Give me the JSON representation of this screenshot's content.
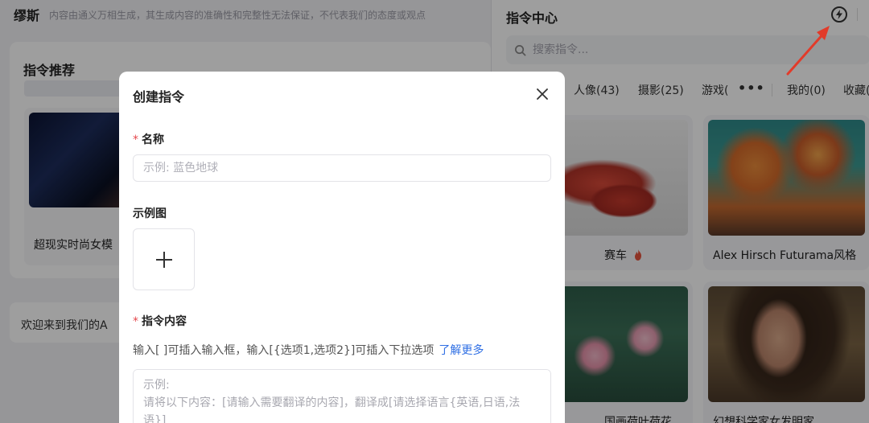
{
  "app": {
    "brand": "缪斯",
    "disclaimer": "内容由通义万相生成，其生成内容的准确性和完整性无法保证，不代表我们的态度或观点"
  },
  "recommend": {
    "title": "指令推荐",
    "card_label": "超现实时尚女模"
  },
  "welcome": {
    "text": "欢迎来到我们的A"
  },
  "command_center": {
    "title": "指令中心",
    "search_placeholder": "搜索指令...",
    "tabs": [
      {
        "label": "人像(43)"
      },
      {
        "label": "摄影(25)"
      },
      {
        "label": "游戏("
      },
      {
        "label": "我的(0)"
      },
      {
        "label": "收藏("
      }
    ],
    "more_glyph": "•••",
    "cards": [
      {
        "label": "赛车",
        "icon": "fire-icon"
      },
      {
        "label": "Alex Hirsch Futurama风格"
      },
      {
        "label": "国画荷叶荷花"
      },
      {
        "label": "幻想科学家女发明家"
      }
    ]
  },
  "modal": {
    "title": "创建指令",
    "name_label": "名称",
    "name_placeholder": "示例: 蓝色地球",
    "example_label": "示例图",
    "content_label": "指令内容",
    "hint_text": "输入[ ]可插入输入框，输入[{选项1,选项2}]可插入下拉选项",
    "learn_more": "了解更多",
    "content_placeholder": "示例:\n请将以下内容：[请输入需要翻译的内容]，翻译成[请选择语言{英语,日语,法语}]",
    "required_mark": "*"
  },
  "colors": {
    "required": "#e5484d",
    "link": "#2f6fe4",
    "arrow": "#e23b2a"
  }
}
